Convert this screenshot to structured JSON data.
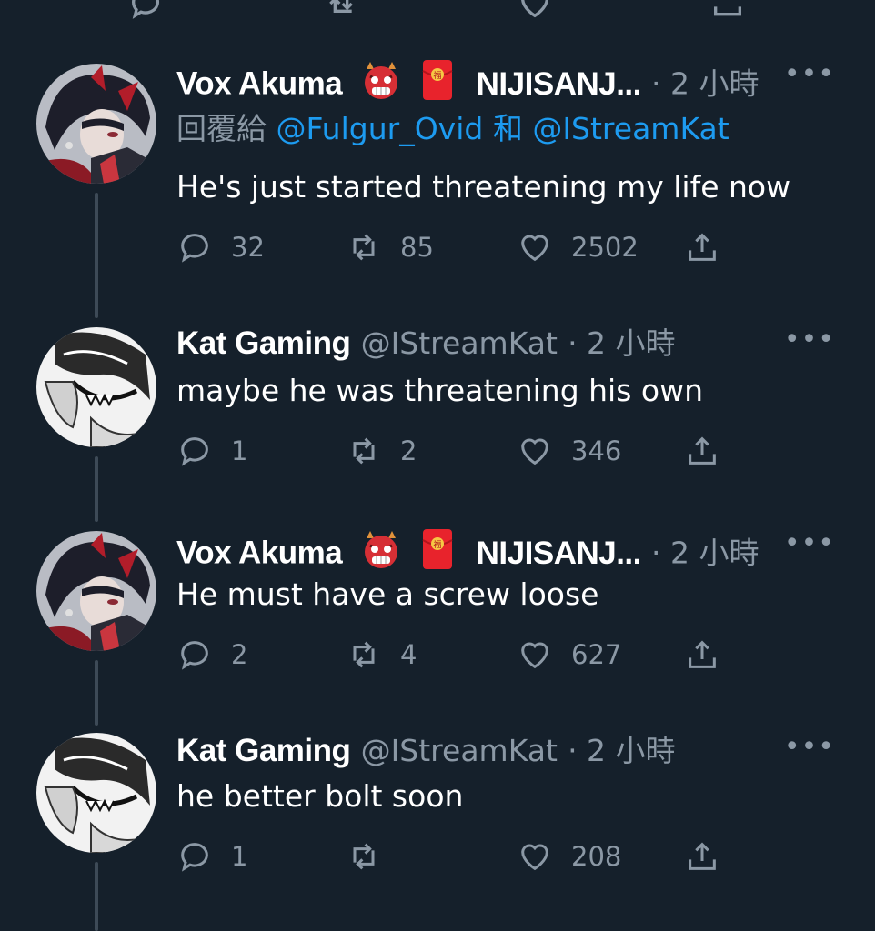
{
  "tweets": [
    {
      "author": "Vox Akuma",
      "handle": "",
      "display_suffix": "NIJISANJ...",
      "time": "· 2 小時",
      "reply_prefix": "回覆給",
      "reply_users": [
        "@Fulgur_Ovid",
        "@IStreamKat"
      ],
      "reply_join": "和",
      "text": "He's just started threatening my life now",
      "replies": "32",
      "retweets": "85",
      "likes": "2502"
    },
    {
      "author": "Kat Gaming",
      "handle": "@IStreamKat",
      "time": "· 2 小時",
      "text": "maybe he was threatening his own",
      "replies": "1",
      "retweets": "2",
      "likes": "346"
    },
    {
      "author": "Vox Akuma",
      "display_suffix": "NIJISANJ...",
      "time": "· 2 小時",
      "text": "He must have a screw loose",
      "replies": "2",
      "retweets": "4",
      "likes": "627"
    },
    {
      "author": "Kat Gaming",
      "handle": "@IStreamKat",
      "time": "· 2 小時",
      "text": "he better bolt soon",
      "replies": "1",
      "retweets": "",
      "likes": "208"
    }
  ],
  "more_label": "•••",
  "icons": {
    "reply": "reply-icon",
    "retweet": "retweet-icon",
    "like": "heart-icon",
    "share": "share-icon",
    "demon": "demon-face-emoji",
    "envelope": "red-envelope-emoji",
    "more": "more-icon"
  },
  "colors": {
    "background": "#15202b",
    "text": "#ffffff",
    "muted": "#8b98a5",
    "link": "#1d9bf0",
    "divider": "#38444d"
  }
}
